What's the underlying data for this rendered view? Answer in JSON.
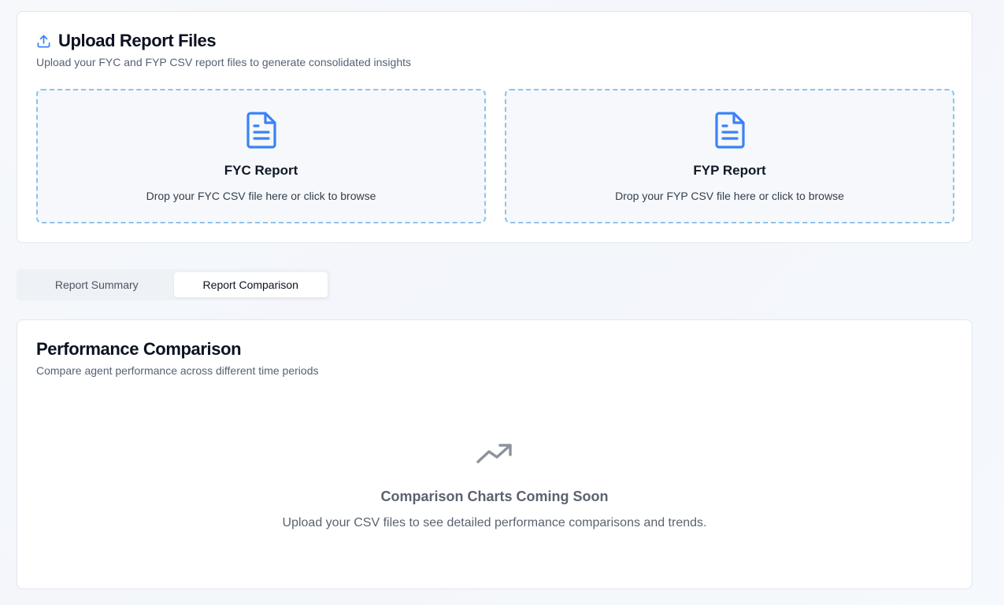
{
  "upload": {
    "title": "Upload Report Files",
    "subtitle": "Upload your FYC and FYP CSV report files to generate consolidated insights",
    "icon": "upload-icon",
    "dropzones": [
      {
        "title": "FYC Report",
        "description": "Drop your FYC CSV file here or click to browse",
        "icon": "file-text-icon"
      },
      {
        "title": "FYP Report",
        "description": "Drop your FYP CSV file here or click to browse",
        "icon": "file-text-icon"
      }
    ]
  },
  "tabs": [
    {
      "label": "Report Summary",
      "active": false
    },
    {
      "label": "Report Comparison",
      "active": true
    }
  ],
  "comparison": {
    "title": "Performance Comparison",
    "subtitle": "Compare agent performance across different time periods",
    "empty_icon": "trending-up-icon",
    "empty_title": "Comparison Charts Coming Soon",
    "empty_description": "Upload your CSV files to see detailed performance comparisons and trends."
  },
  "colors": {
    "accent": "#3b82f6",
    "dropzone_border": "#90c2ea",
    "muted_icon": "#8b929c"
  }
}
